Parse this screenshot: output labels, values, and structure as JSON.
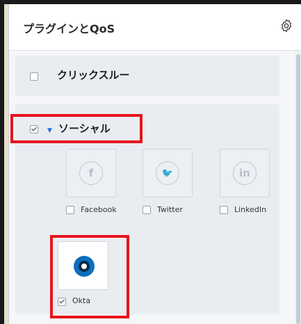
{
  "panel": {
    "title": "プラグインとQoS"
  },
  "click_through": {
    "label": "クリックスルー",
    "checked": false
  },
  "social": {
    "label": "ソーシャル",
    "checked": true,
    "networks": [
      {
        "name": "Facebook",
        "glyph": "f",
        "checked": false
      },
      {
        "name": "Twitter",
        "glyph": "🐦",
        "checked": false
      },
      {
        "name": "LinkedIn",
        "glyph": "in",
        "checked": false
      }
    ],
    "okta": {
      "name": "Okta",
      "checked": true
    }
  },
  "colors": {
    "highlight": "#e8141c",
    "okta_blue": "#0b6fc0",
    "caret": "#1e6fd9"
  }
}
